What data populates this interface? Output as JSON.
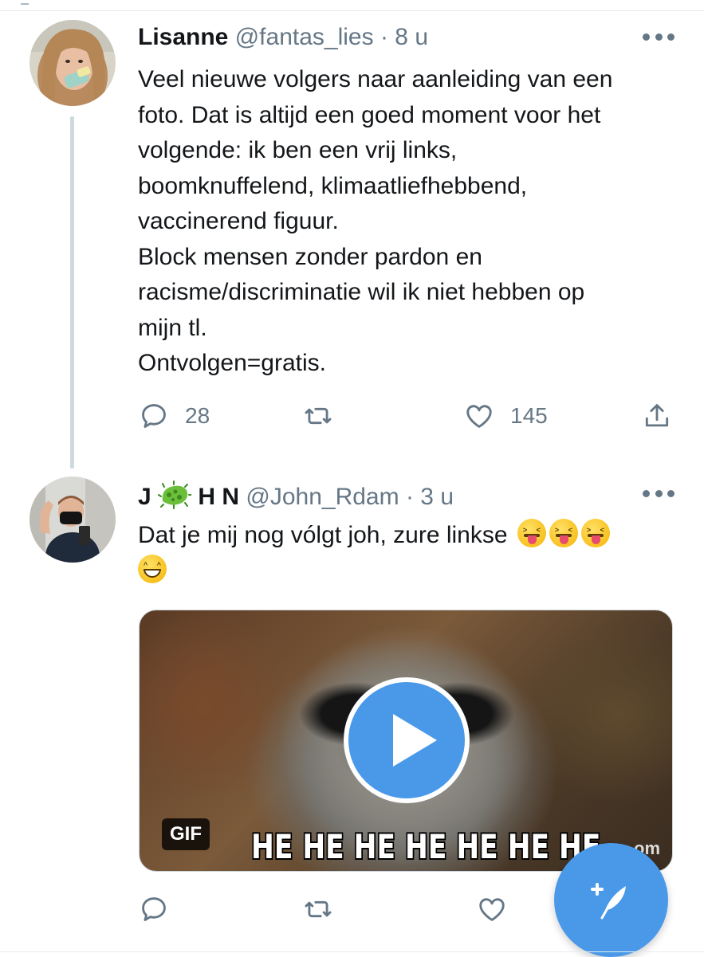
{
  "tweets": [
    {
      "name": "Lisanne",
      "handle": "@fantas_lies",
      "separator": "·",
      "time": "8 u",
      "text_lines": [
        "Veel nieuwe volgers naar aanleiding van een",
        "foto. Dat is altijd een goed moment voor het",
        "volgende: ik ben een vrij links,",
        "boomknuffelend, klimaatliefhebbend,",
        "vaccinerend figuur.",
        "Block mensen zonder pardon en",
        "racisme/discriminatie wil ik niet hebben op",
        "mijn tl.",
        "Ontvolgen=gratis."
      ],
      "reply_count": "28",
      "retweet_count": "",
      "like_count": "145"
    },
    {
      "name_part1": "J",
      "name_emoji": "microbe-icon",
      "name_part2": "H N",
      "handle": "@John_Rdam",
      "separator": "·",
      "time": "3 u",
      "text_line1": "Dat je mij nog vólgt joh, zure linkse",
      "emojis": [
        "squinting-tongue-face",
        "squinting-tongue-face",
        "squinting-tongue-face",
        "grinning-face"
      ],
      "gif": {
        "badge": "GIF",
        "caption": "HE HE HE HE HE HE HE",
        "watermark": "om"
      }
    }
  ],
  "colors": {
    "accent": "#4a99e9",
    "muted": "#657786",
    "text": "#14171a",
    "divider": "#e6ecf0"
  }
}
